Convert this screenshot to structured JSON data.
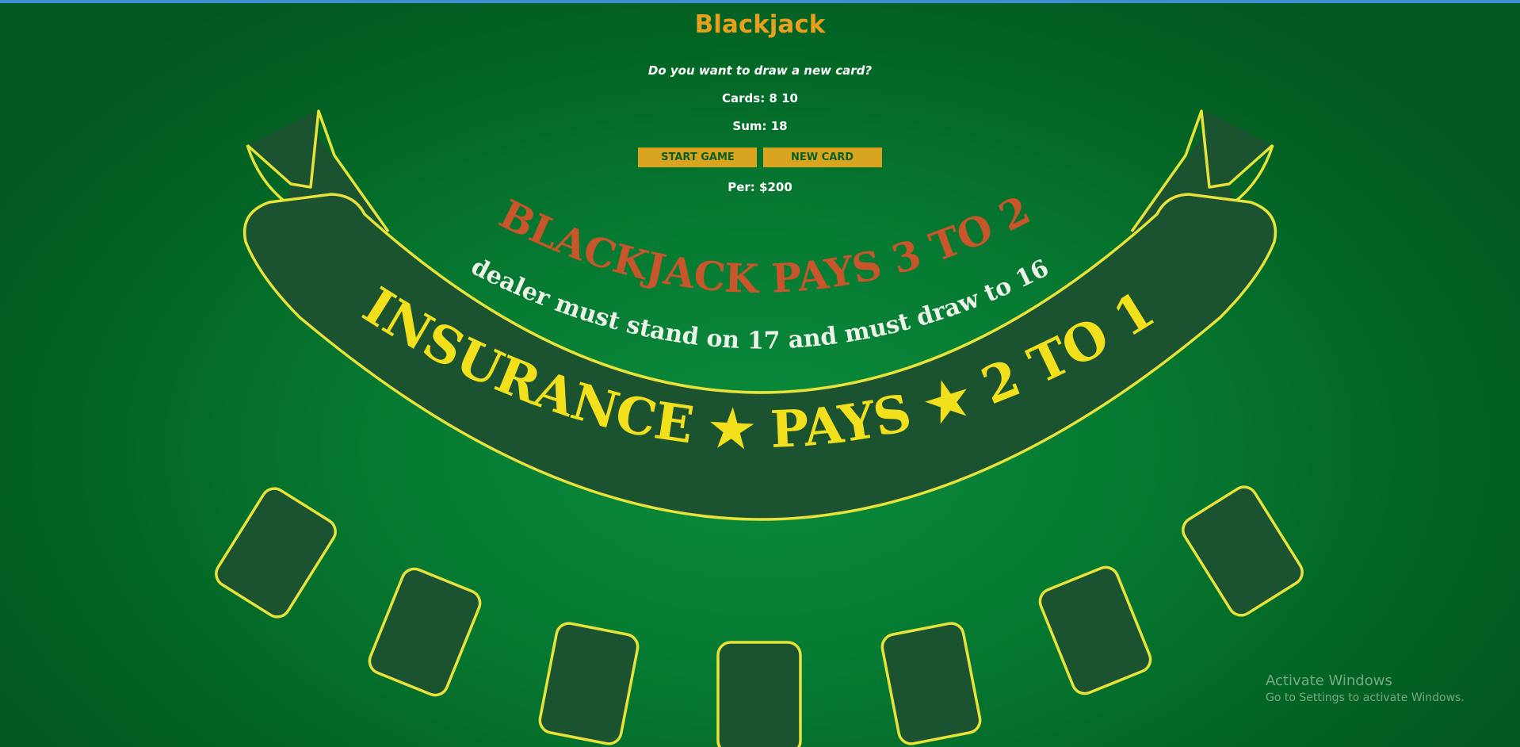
{
  "game": {
    "title": "Blackjack",
    "message": "Do you want to draw a new card?",
    "cards": "Cards: 8 10",
    "sum": "Sum: 18",
    "player": "Per: $200"
  },
  "buttons": {
    "start_label": "START GAME",
    "new_card_label": "NEW CARD"
  },
  "table": {
    "blackjack_text": "BLACKJACK PAYS 3 TO 2",
    "dealer_text": "dealer must stand on 17 and must draw to 16",
    "insurance_text": "INSURANCE ★ PAYS ★ 2 TO 1"
  },
  "watermark": {
    "title": "Activate Windows",
    "subtitle": "Go to Settings to activate Windows."
  },
  "colors": {
    "felt": "#067a32",
    "accent_gold": "#e7a01e",
    "button_bg": "#d9a420",
    "line_yellow": "#e8e33a",
    "banner_fill": "#1b5230",
    "blackjack_text": "#c8562a"
  }
}
